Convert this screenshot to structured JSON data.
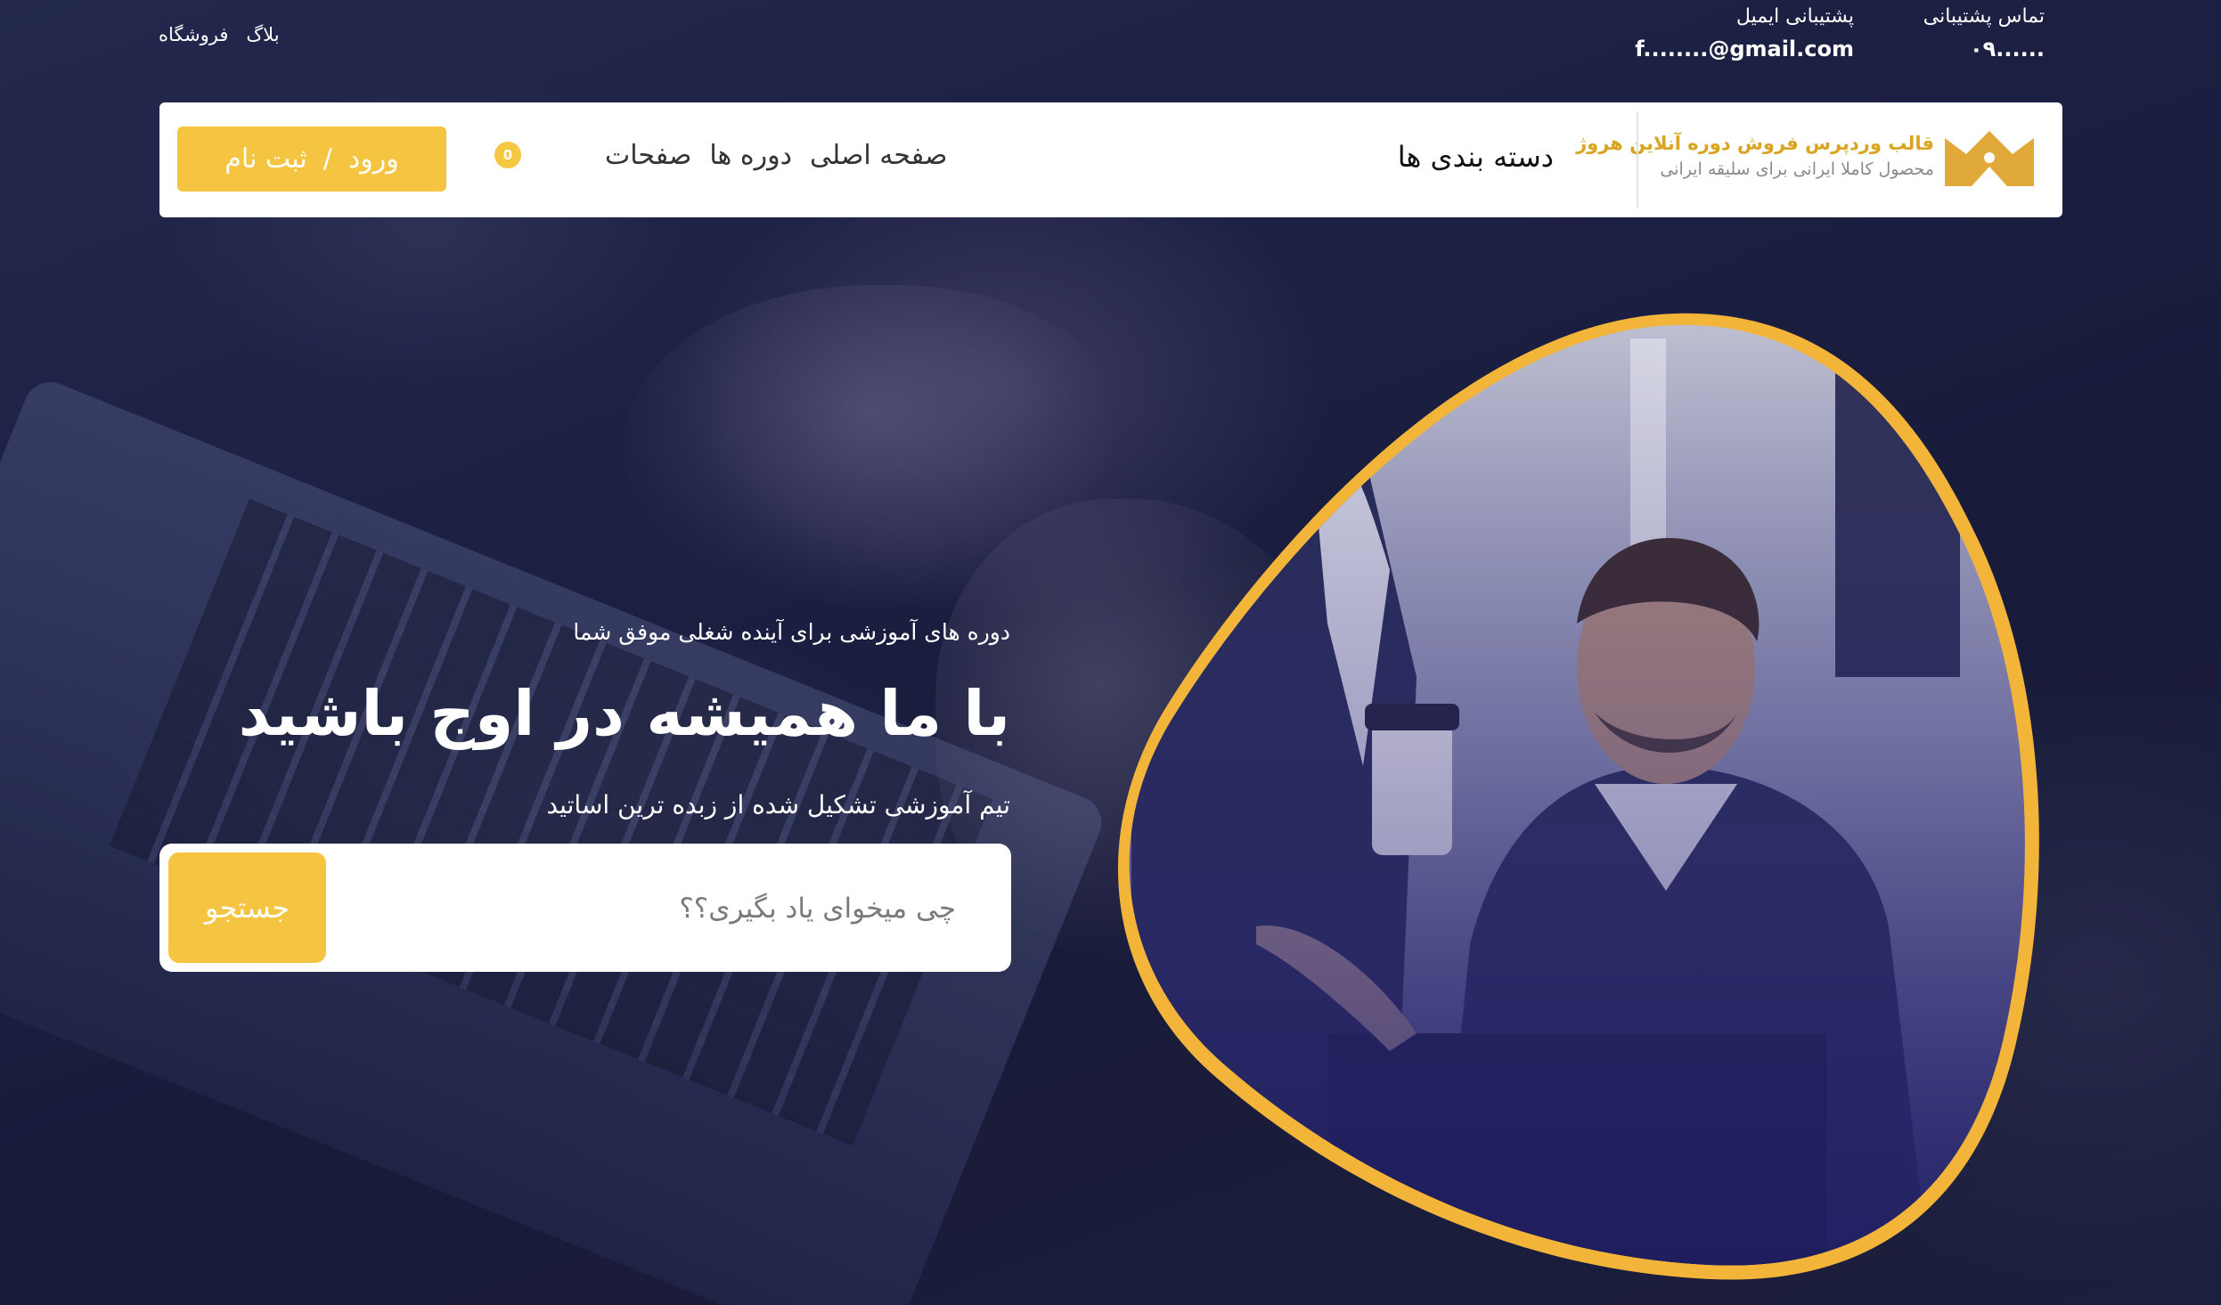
{
  "topbar": {
    "links": [
      "بلاگ",
      "فروشگاه"
    ],
    "support_phone": {
      "label": "تماس پشتیبانی",
      "value": "۰۹......"
    },
    "support_email": {
      "label": "پشتیبانی ایمیل",
      "value": "f........@gmail.com"
    }
  },
  "header": {
    "logo_title": "قالب وردپرس فروش دوره آنلاین هروژ",
    "logo_subtitle": "محصول کاملا ایرانی برای سلیقه ایرانی",
    "categories": "دسته بندی ها",
    "nav": [
      "صفحه اصلی",
      "دوره ها",
      "صفحات"
    ],
    "cart_count": "0",
    "auth": {
      "login": "ورود",
      "separator": "/",
      "register": "ثبت نام"
    }
  },
  "hero": {
    "subtitle": "دوره های آموزشی برای آینده شغلی موفق شما",
    "title": "با ما همیشه در اوج باشید",
    "description": "تیم آموزشی تشکیل شده از زبده ترین اساتید",
    "search_placeholder": "چی میخوای یاد بگیری؟؟",
    "search_button": "جستجو"
  },
  "colors": {
    "accent": "#f5c542",
    "background": "#1f2447",
    "header_bg": "#ffffff"
  },
  "icons": {
    "logo": "crown-logo-icon",
    "cart": "cart-badge-icon"
  }
}
